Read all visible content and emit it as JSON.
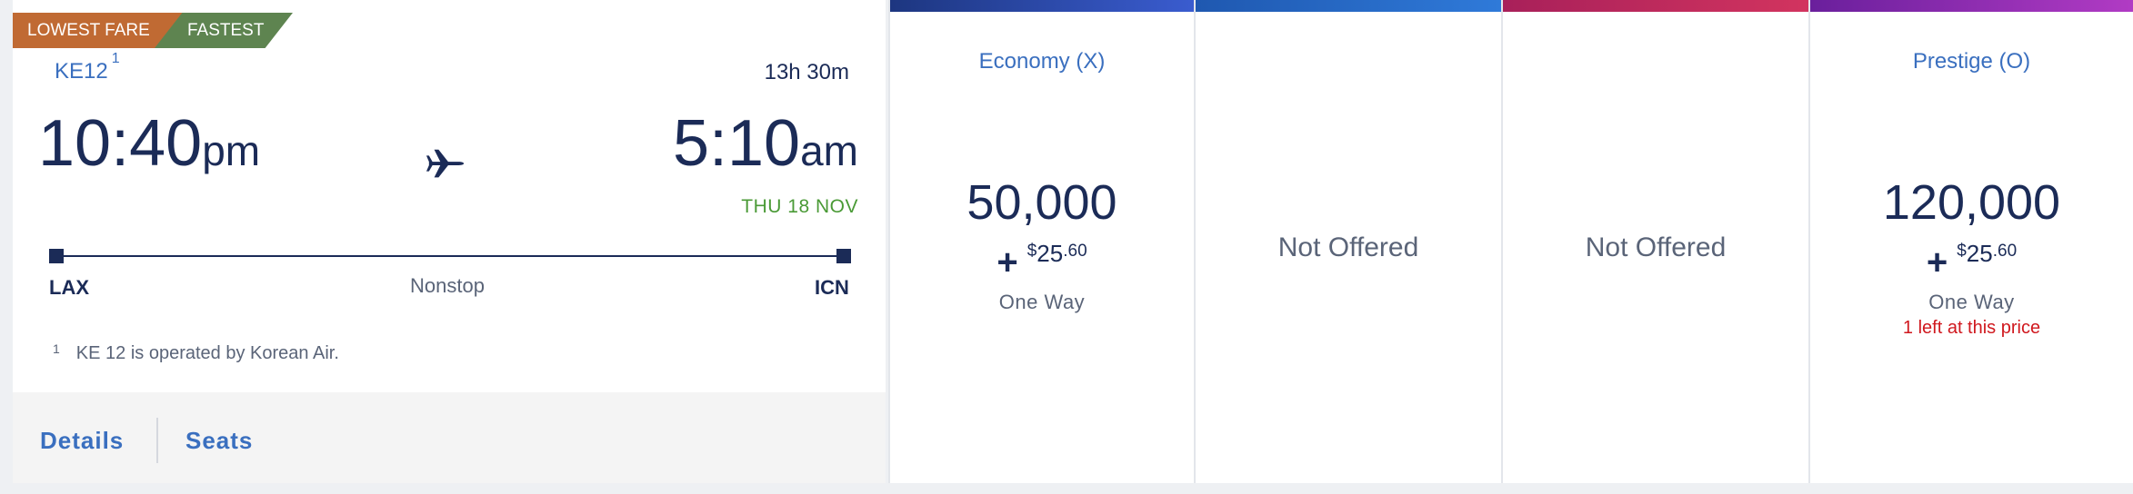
{
  "tags": {
    "lowest_fare": "LOWEST FARE",
    "fastest": "FASTEST"
  },
  "flight": {
    "number": "KE12",
    "footnote_marker": "1",
    "duration": "13h 30m",
    "departure": {
      "time": "10:40",
      "ampm": "pm",
      "airport": "LAX"
    },
    "arrival": {
      "time": "5:10",
      "ampm": "am",
      "airport": "ICN",
      "date_note": "THU 18 NOV"
    },
    "stops": "Nonstop",
    "footnote_text": "KE 12 is operated by Korean Air.",
    "aircraft_icon": "airplane-icon"
  },
  "footer": {
    "details": "Details",
    "seats": "Seats"
  },
  "fares": [
    {
      "title": "Economy (X)",
      "miles": "50,000",
      "plus": "+",
      "fee_currency": "$",
      "fee_dollars": "25",
      "fee_cents": ".60",
      "trip": "One Way",
      "accent": "#2b47a8"
    },
    {
      "status": "Not Offered",
      "accent": "#2b6cc8"
    },
    {
      "status": "Not Offered",
      "accent": "#c02a5c"
    },
    {
      "title": "Prestige (O)",
      "miles": "120,000",
      "plus": "+",
      "fee_currency": "$",
      "fee_dollars": "25",
      "fee_cents": ".60",
      "trip": "One Way",
      "scarcity": "1 left at this price",
      "accent": "#8a2db0"
    }
  ]
}
